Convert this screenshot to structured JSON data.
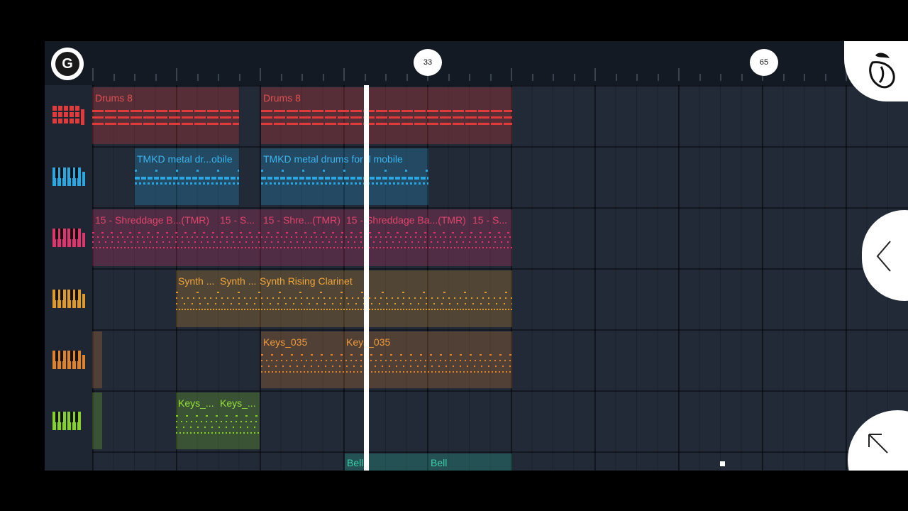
{
  "ruler": {
    "marker_left": "33",
    "marker_right": "65"
  },
  "tracks": [
    {
      "icon": "drum-pads-icon",
      "color": "#e03a3a"
    },
    {
      "icon": "piano-icon",
      "color": "#2aa6e0"
    },
    {
      "icon": "piano-icon",
      "color": "#e0356a"
    },
    {
      "icon": "piano-icon",
      "color": "#e09a2a"
    },
    {
      "icon": "piano-icon",
      "color": "#e0822a"
    },
    {
      "icon": "piano-icon",
      "color": "#86d02a"
    }
  ],
  "clips": {
    "drums_a": "Drums 8",
    "drums_b": "Drums 8",
    "tmkd_a": "TMKD metal dr...obile",
    "tmkd_b": "TMKD metal drums for fl mobile",
    "shred_a": "15 - Shreddage B...(TMR)",
    "shred_b": "15 - S...",
    "shred_c": "15 - Shre...(TMR)",
    "shred_d": "15 - Shreddage Ba...(TMR)",
    "shred_e": "15 - S...",
    "synth_a": "Synth ...",
    "synth_b": "Synth ...",
    "synth_c": "Synth Rising Clarinet",
    "keys_a": "Keys_035",
    "keys_b": "Keys_035",
    "keysg_a": "Keys_...",
    "keysg_b": "Keys_...",
    "bell_a": "Bell",
    "bell_b": "Bell"
  },
  "colors": {
    "drums": "#e03a3a",
    "tmkd": "#2aa6e0",
    "shred": "#e0356a",
    "synth": "#e09a2a",
    "keys": "#e0822a",
    "keysg": "#86d02a",
    "bell": "#2ab89a"
  }
}
